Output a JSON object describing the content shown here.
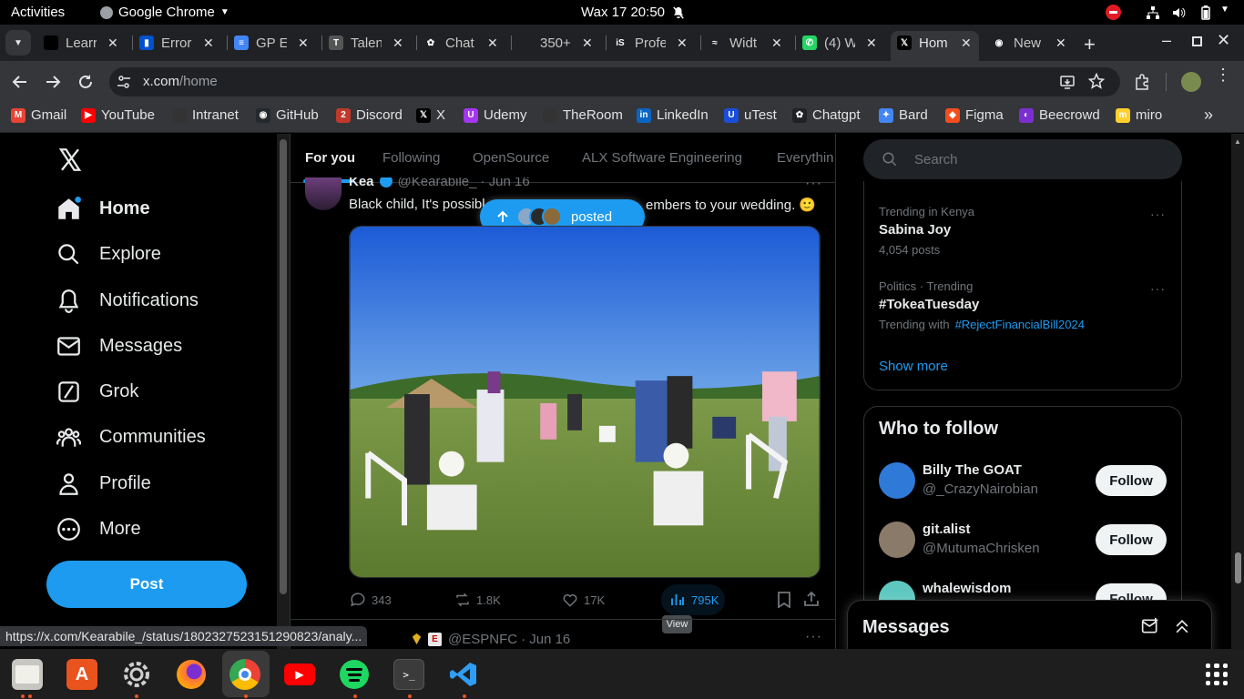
{
  "topbar": {
    "activities": "Activities",
    "app": "Google Chrome",
    "clock": "Wax 17  20:50"
  },
  "tabs": [
    {
      "title": "Learr",
      "fav": "learn-icon"
    },
    {
      "title": "Error",
      "fav": "trello-icon"
    },
    {
      "title": "GP E",
      "fav": "docs-icon"
    },
    {
      "title": "Talen",
      "fav": "talent-icon"
    },
    {
      "title": "Chat",
      "fav": "chatgpt-icon"
    },
    {
      "title": "350+",
      "fav": "blank-icon"
    },
    {
      "title": "Profe",
      "fav": "is-icon"
    },
    {
      "title": "Widt",
      "fav": "tailwind-icon"
    },
    {
      "title": "(4) W",
      "fav": "whatsapp-icon"
    },
    {
      "title": "Hom",
      "fav": "x-icon"
    },
    {
      "title": "New",
      "fav": "chrome-icon"
    }
  ],
  "url": {
    "domain": "x.com",
    "path": "/home"
  },
  "bookmarks": [
    "Gmail",
    "YouTube",
    "Intranet",
    "GitHub",
    "Discord",
    "X",
    "Udemy",
    "TheRoom",
    "LinkedIn",
    "uTest",
    "Chatgpt",
    "Bard",
    "Figma",
    "Beecrowd",
    "miro"
  ],
  "sidebar": {
    "items": [
      {
        "label": "Home",
        "icon": "home-icon"
      },
      {
        "label": "Explore",
        "icon": "search-icon"
      },
      {
        "label": "Notifications",
        "icon": "bell-icon"
      },
      {
        "label": "Messages",
        "icon": "mail-icon"
      },
      {
        "label": "Grok",
        "icon": "grok-icon"
      },
      {
        "label": "Communities",
        "icon": "communities-icon"
      },
      {
        "label": "Profile",
        "icon": "profile-icon"
      },
      {
        "label": "More",
        "icon": "more-icon"
      }
    ],
    "post_button": "Post"
  },
  "feed": {
    "tabs": [
      "For you",
      "Following",
      "OpenSource",
      "ALX Software Engineering",
      "Everythin"
    ],
    "new_posts_pill": "posted",
    "tweet": {
      "name": "Kea",
      "handle": "@Kearabile_",
      "date": "· Jun 16",
      "text": "Black child, It's possibl",
      "text_tail": "embers to your wedding. 🙂",
      "replies": "343",
      "reposts": "1.8K",
      "likes": "17K",
      "views": "795K",
      "tooltip": "View"
    },
    "next_tweet": {
      "handle": "@ESPNFC",
      "date": "· Jun 16"
    }
  },
  "right": {
    "search_placeholder": "Search",
    "trends": [
      {
        "context": "Trending in Kenya",
        "title": "Sabina Joy",
        "meta": "4,054 posts"
      },
      {
        "context": "Politics · Trending",
        "title": "#TokeaTuesday",
        "meta_prefix": "Trending with",
        "meta_link": "#RejectFinancialBill2024"
      }
    ],
    "show_more": "Show more",
    "who_to_follow": "Who to follow",
    "follow_list": [
      {
        "name": "Billy The GOAT",
        "handle": "@_CrazyNairobian",
        "button": "Follow"
      },
      {
        "name": "git.alist",
        "handle": "@MutumaChrisken",
        "button": "Follow"
      },
      {
        "name": "whalewisdom",
        "handle": "",
        "button": "Follow"
      }
    ],
    "messages_title": "Messages"
  },
  "status_url": "https://x.com/Kearabile_/status/1802327523151290823/analy...",
  "colors": {
    "accent": "#1d9bf0",
    "bg": "#000000",
    "muted": "#71767b"
  }
}
